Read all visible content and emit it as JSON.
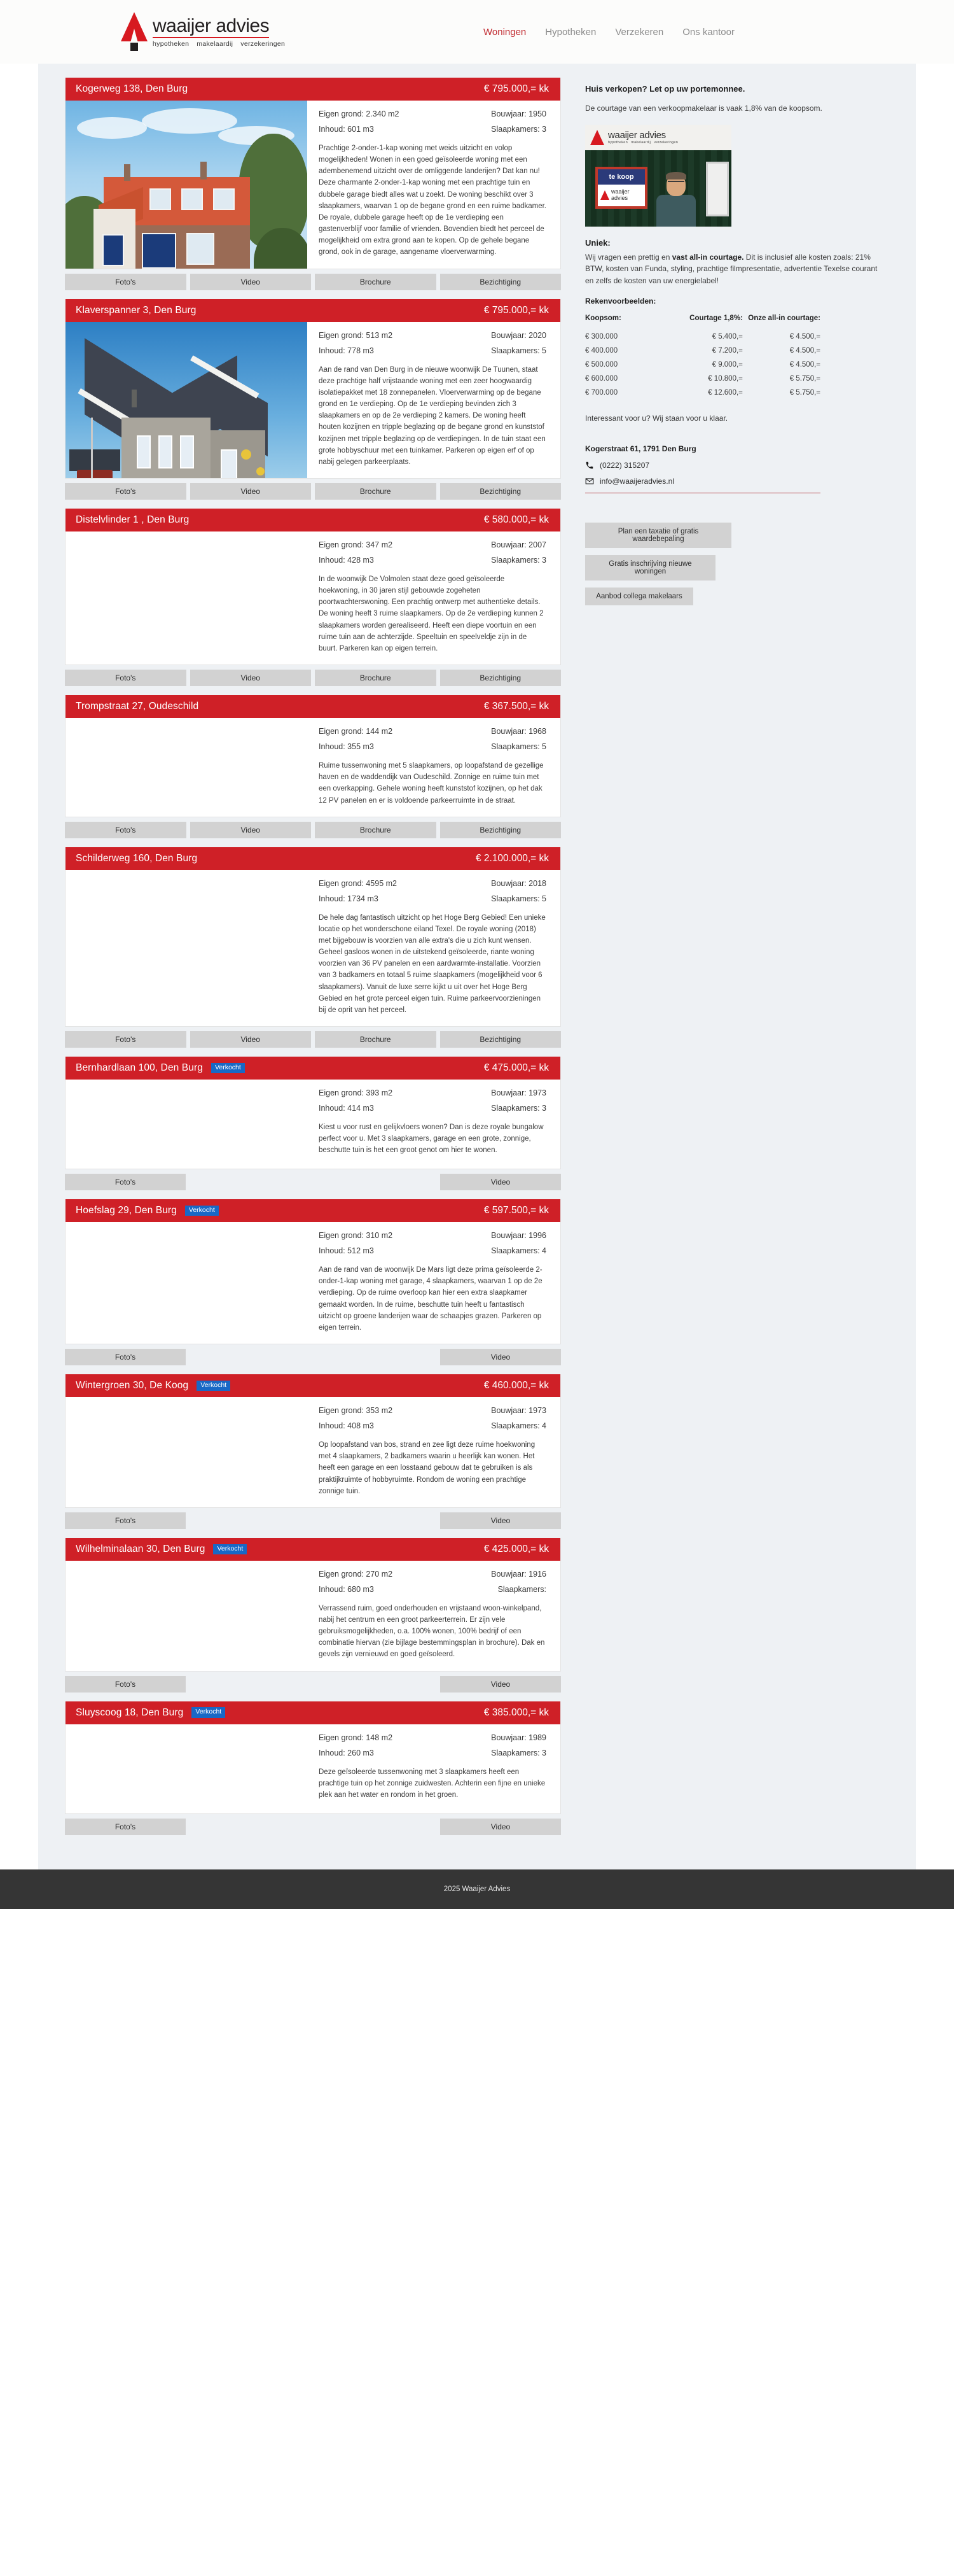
{
  "header": {
    "logo": {
      "title": "waaijer advies",
      "sub": [
        "hypotheken",
        "makelaardij",
        "verzekeringen"
      ]
    },
    "nav": [
      {
        "label": "Woningen",
        "active": true
      },
      {
        "label": "Hypotheken",
        "active": false
      },
      {
        "label": "Verzekeren",
        "active": false
      },
      {
        "label": "Ons kantoor",
        "active": false
      }
    ]
  },
  "labels": {
    "sold_badge": "Verkocht",
    "btn_photos": "Foto's",
    "btn_video": "Video",
    "btn_brochure": "Brochure",
    "btn_viewing": "Bezichtiging"
  },
  "properties": [
    {
      "address": "Kogerweg 138, Den Burg",
      "price": "€ 795.000,= kk",
      "sold": false,
      "land": "Eigen grond: 2.340 m2",
      "year": "Bouwjaar: 1950",
      "volume": "Inhoud: 601 m3",
      "bedrooms": "Slaapkamers: 3",
      "description": "Prachtige 2-onder-1-kap woning met weids uitzicht en volop mogelijkheden! Wonen in een goed geïsoleerde woning met een adembenemend uitzicht over de omliggende landerijen? Dat kan nu! Deze charmante 2-onder-1-kap woning met een prachtige tuin en dubbele garage biedt alles wat u zoekt. De woning beschikt over 3 slaapkamers, waarvan 1 op de begane grond en een ruime badkamer. De royale, dubbele garage heeft op de 1e verdieping een gastenverblijf voor familie of vrienden. Bovendien biedt het perceel de mogelijkheid om extra grond aan te kopen. Op de gehele begane grond, ook in de garage, aangename vloerverwarming.",
      "photo": "house-brick-orange-roof",
      "buttons": [
        "Foto's",
        "Video",
        "Brochure",
        "Bezichtiging"
      ]
    },
    {
      "address": "Klaverspanner 3, Den Burg",
      "price": "€ 795.000,= kk",
      "sold": false,
      "land": "Eigen grond: 513 m2",
      "year": "Bouwjaar: 2020",
      "volume": "Inhoud: 778 m3",
      "bedrooms": "Slaapkamers: 5",
      "description": "Aan de rand van Den Burg in de nieuwe woonwijk De Tuunen, staat deze prachtige half vrijstaande woning met een zeer hoogwaardig isolatiepakket met 18 zonnepanelen. Vloerverwarming op de begane grond en 1e verdieping. Op de 1e verdieping bevinden zich 3 slaapkamers en op de 2e verdieping 2 kamers. De woning heeft houten kozijnen en tripple beglazing op de begane grond en kunststof kozijnen met tripple beglazing op de verdiepingen. In de tuin staat een grote hobbyschuur met een tuinkamer. Parkeren op eigen erf of op nabij gelegen parkeerplaats.",
      "photo": "house-grey-modern",
      "buttons": [
        "Foto's",
        "Video",
        "Brochure",
        "Bezichtiging"
      ]
    },
    {
      "address": "Distelvlinder 1 , Den Burg",
      "price": "€ 580.000,= kk",
      "sold": false,
      "land": "Eigen grond: 347 m2",
      "year": "Bouwjaar: 2007",
      "volume": "Inhoud: 428 m3",
      "bedrooms": "Slaapkamers: 3",
      "description": "In de woonwijk De Volmolen staat deze goed geïsoleerde hoekwoning, in 30 jaren stijl gebouwde zogeheten poortwachterswoning. Een prachtig ontwerp met authentieke details. De woning heeft 3 ruime slaapkamers. Op de 2e verdieping kunnen 2 slaapkamers worden gerealiseerd. Heeft een diepe voortuin en een ruime tuin aan de achterzijde. Speeltuin en speelveldje zijn in de buurt. Parkeren kan op eigen terrein.",
      "photo": "none",
      "buttons": [
        "Foto's",
        "Video",
        "Brochure",
        "Bezichtiging"
      ]
    },
    {
      "address": "Trompstraat 27, Oudeschild",
      "price": "€ 367.500,= kk",
      "sold": false,
      "land": "Eigen grond: 144 m2",
      "year": "Bouwjaar: 1968",
      "volume": "Inhoud: 355 m3",
      "bedrooms": "Slaapkamers: 5",
      "description": "Ruime tussenwoning met 5 slaapkamers, op loopafstand de gezellige haven en de waddendijk van Oudeschild. Zonnige en ruime tuin met een overkapping. Gehele woning heeft kunststof kozijnen, op het dak 12 PV panelen en er is voldoende parkeerruimte in de straat.",
      "photo": "none",
      "buttons": [
        "Foto's",
        "Video",
        "Brochure",
        "Bezichtiging"
      ]
    },
    {
      "address": "Schilderweg 160, Den Burg",
      "price": "€ 2.100.000,= kk",
      "sold": false,
      "land": "Eigen grond: 4595 m2",
      "year": "Bouwjaar: 2018",
      "volume": "Inhoud: 1734 m3",
      "bedrooms": "Slaapkamers: 5",
      "description": "De hele dag fantastisch uitzicht op het Hoge Berg Gebied! Een unieke locatie op het wonderschone eiland Texel. De royale woning (2018) met bijgebouw is voorzien van alle extra's die u zich kunt wensen. Geheel gasloos wonen in de uitstekend geïsoleerde, riante woning voorzien van 36 PV panelen en een aardwarmte-installatie. Voorzien van 3 badkamers en totaal 5 ruime slaapkamers (mogelijkheid voor 6 slaapkamers). Vanuit de luxe serre kijkt u uit over het Hoge Berg Gebied en het grote perceel eigen tuin. Ruime parkeervoorzieningen bij de oprit van het perceel.",
      "photo": "none",
      "buttons": [
        "Foto's",
        "Video",
        "Brochure",
        "Bezichtiging"
      ]
    },
    {
      "address": "Bernhardlaan 100, Den Burg",
      "price": "€ 475.000,= kk",
      "sold": true,
      "land": "Eigen grond: 393 m2",
      "year": "Bouwjaar: 1973",
      "volume": "Inhoud: 414 m3",
      "bedrooms": "Slaapkamers: 3",
      "description": "Kiest u voor rust en gelijkvloers wonen? Dan is deze royale bungalow perfect voor u. Met 3 slaapkamers, garage en een grote, zonnige, beschutte tuin is het een groot genot om hier te wonen.",
      "photo": "none",
      "buttons": [
        "Foto's",
        "Video"
      ]
    },
    {
      "address": "Hoefslag 29, Den Burg",
      "price": "€ 597.500,= kk",
      "sold": true,
      "land": "Eigen grond: 310 m2",
      "year": "Bouwjaar: 1996",
      "volume": "Inhoud: 512 m3",
      "bedrooms": "Slaapkamers: 4",
      "description": "Aan de rand van de woonwijk De Mars ligt deze prima geïsoleerde 2-onder-1-kap woning met garage, 4 slaapkamers, waarvan 1 op de 2e verdieping. Op de ruime overloop kan hier een extra slaapkamer gemaakt worden. In de ruime, beschutte tuin heeft u fantastisch uitzicht op groene landerijen waar de schaapjes grazen. Parkeren op eigen terrein.",
      "photo": "none",
      "buttons": [
        "Foto's",
        "Video"
      ]
    },
    {
      "address": "Wintergroen 30, De Koog",
      "price": "€ 460.000,= kk",
      "sold": true,
      "land": "Eigen grond: 353 m2",
      "year": "Bouwjaar: 1973",
      "volume": "Inhoud: 408 m3",
      "bedrooms": "Slaapkamers: 4",
      "description": "Op loopafstand van bos, strand en zee ligt deze ruime hoekwoning met 4 slaapkamers, 2 badkamers waarin u heerlijk kan wonen. Het heeft een garage en een losstaand gebouw dat te gebruiken is als praktijkruimte of hobbyruimte. Rondom de woning een prachtige zonnige tuin.",
      "photo": "none",
      "buttons": [
        "Foto's",
        "Video"
      ]
    },
    {
      "address": "Wilhelminalaan 30, Den Burg",
      "price": "€ 425.000,= kk",
      "sold": true,
      "land": "Eigen grond: 270 m2",
      "year": "Bouwjaar: 1916",
      "volume": "Inhoud: 680 m3",
      "bedrooms": "Slaapkamers:",
      "description": "Verrassend ruim, goed onderhouden en vrijstaand woon-winkelpand, nabij het centrum en een groot parkeerterrein. Er zijn vele gebruiksmogelijkheden, o.a. 100% wonen, 100% bedrijf of een combinatie hiervan (zie bijlage bestemmingsplan in brochure). Dak en gevels zijn vernieuwd en goed geïsoleerd.",
      "photo": "none",
      "buttons": [
        "Foto's",
        "Video"
      ]
    },
    {
      "address": "Sluyscoog 18, Den Burg",
      "price": "€ 385.000,= kk",
      "sold": true,
      "land": "Eigen grond: 148 m2",
      "year": "Bouwjaar: 1989",
      "volume": "Inhoud: 260 m3",
      "bedrooms": "Slaapkamers: 3",
      "description": "Deze geïsoleerde tussenwoning met 3 slaapkamers heeft een prachtige tuin op het zonnige zuidwesten. Achterin een fijne en unieke plek aan het water en rondom in het groen.",
      "photo": "none",
      "buttons": [
        "Foto's",
        "Video"
      ]
    }
  ],
  "sidebar": {
    "heading": "Huis verkopen? Let op uw portemonnee.",
    "intro": "De courtage van een verkoopmakelaar is vaak 1,8% van de koopsom.",
    "photo": {
      "logo_title": "waaijer advies",
      "logo_sub": [
        "hypotheken",
        "makelaardij",
        "verzekeringen"
      ],
      "sign_top": "te koop",
      "sign_bottom": "waaijer advies"
    },
    "unique_title": "Uniek:",
    "unique_text_1": "Wij vragen een prettig en ",
    "unique_text_bold": "vast all-in courtage.",
    "unique_text_2": " Dit is inclusief alle kosten zoals: 21% BTW, kosten van Funda, styling, prachtige filmpresentatie, advertentie Texelse courant en zelfs de kosten van uw energielabel!",
    "rekenvoorbeelden_title": "Rekenvoorbeelden:",
    "table": {
      "headers": [
        "Koopsom:",
        "Courtage 1,8%:",
        "Onze all-in courtage:"
      ],
      "rows": [
        [
          "€ 300.000",
          "€   5.400,=",
          "€ 4.500,="
        ],
        [
          "€ 400.000",
          "€   7.200,=",
          "€ 4.500,="
        ],
        [
          "€ 500.000",
          "€   9.000,=",
          "€ 4.500,="
        ],
        [
          "€ 600.000",
          "€ 10.800,=",
          "€ 5.750,="
        ],
        [
          "€ 700.000",
          "€ 12.600,=",
          "€ 5.750,="
        ]
      ]
    },
    "note": "Interessant voor u? Wij staan voor u klaar.",
    "contact": {
      "address": "Kogerstraat 61, 1791 Den Burg",
      "phone": "(0222) 315207",
      "email": "info@waaijeradvies.nl"
    },
    "buttons": [
      "Plan een taxatie of gratis waardebepaling",
      "Gratis inschrijving nieuwe woningen",
      "Aanbod collega makelaars"
    ]
  },
  "footer": {
    "copyright": "2025 Waaijer Advies"
  }
}
